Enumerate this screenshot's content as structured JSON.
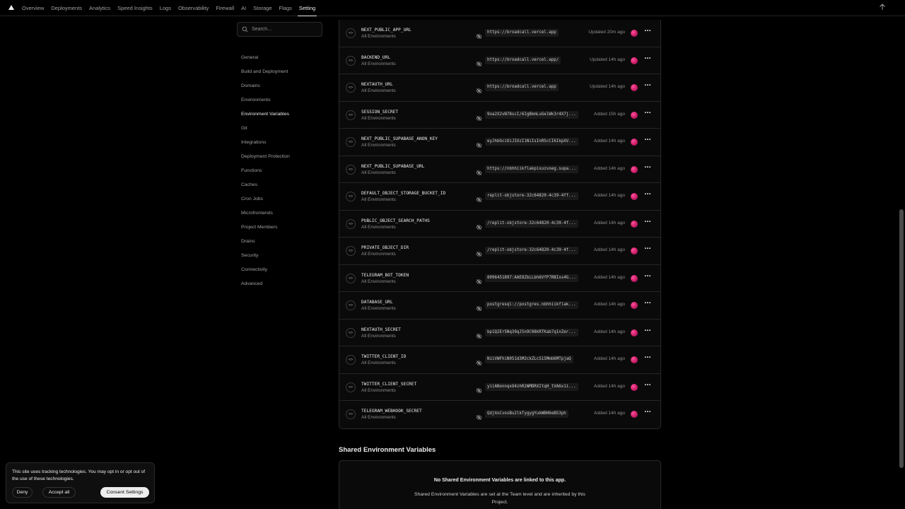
{
  "nav": {
    "tabs": [
      {
        "label": "Overview"
      },
      {
        "label": "Deployments"
      },
      {
        "label": "Analytics"
      },
      {
        "label": "Speed Insights"
      },
      {
        "label": "Logs"
      },
      {
        "label": "Observability"
      },
      {
        "label": "Firewall"
      },
      {
        "label": "AI"
      },
      {
        "label": "Storage"
      },
      {
        "label": "Flags"
      },
      {
        "label": "Setting"
      }
    ],
    "active_tab": "Setting"
  },
  "sidebar": {
    "search_placeholder": "Search...",
    "items": [
      {
        "label": "General"
      },
      {
        "label": "Build and Deployment"
      },
      {
        "label": "Domains"
      },
      {
        "label": "Environments"
      },
      {
        "label": "Environment Variables"
      },
      {
        "label": "Git"
      },
      {
        "label": "Integrations"
      },
      {
        "label": "Deployment Protection"
      },
      {
        "label": "Functions"
      },
      {
        "label": "Caches"
      },
      {
        "label": "Cron Jobs"
      },
      {
        "label": "Microfrontends"
      },
      {
        "label": "Project Members"
      },
      {
        "label": "Drains"
      },
      {
        "label": "Security"
      },
      {
        "label": "Connectivity"
      },
      {
        "label": "Advanced"
      }
    ],
    "active_item": "Environment Variables"
  },
  "env_vars": [
    {
      "name": "NEXT_PUBLIC_APP_URL",
      "env": "All Environments",
      "value": "https://broadcall.vercel.app",
      "time": "Updated 20m ago"
    },
    {
      "name": "BACKEND_URL",
      "env": "All Environments",
      "value": "https://broadcall.vercel.app/",
      "time": "Updated 14h ago"
    },
    {
      "name": "NEXTAUTH_URL",
      "env": "All Environments",
      "value": "https://broadcall.vercel.app",
      "time": "Updated 14h ago"
    },
    {
      "name": "SESSION_SECRET",
      "env": "All Environments",
      "value": "9oa2X2vN78scI/6IgBkmLuGelWk3r4X7j...",
      "time": "Added 15h ago"
    },
    {
      "name": "NEXT_PUBLIC_SUPABASE_ANON_KEY",
      "env": "All Environments",
      "value": "eyJhbGciOiJIUzI1NiIsInR5cCI6IkpXV...",
      "time": "Added 14h ago"
    },
    {
      "name": "NEXT_PUBLIC_SUPABASE_URL",
      "env": "All Environments",
      "value": "https://nbhhiikflakpixuzvoeg.supa...",
      "time": "Added 14h ago"
    },
    {
      "name": "DEFAULT_OBJECT_STORAGE_BUCKET_ID",
      "env": "All Environments",
      "value": "replit-objstore-32c64820-4c39-4ff...",
      "time": "Added 14h ago"
    },
    {
      "name": "PUBLIC_OBJECT_SEARCH_PATHS",
      "env": "All Environments",
      "value": "/replit-objstore-32c64820-4c39-4f...",
      "time": "Added 14h ago"
    },
    {
      "name": "PRIVATE_OBJECT_DIR",
      "env": "All Environments",
      "value": "/replit-objstore-32c64820-4c39-4f...",
      "time": "Added 14h ago"
    },
    {
      "name": "TELEGRAM_BOT_TOKEN",
      "env": "All Environments",
      "value": "8096451897:AAE8ZbLLbh6VfP7RBIxs4G...",
      "time": "Added 14h ago"
    },
    {
      "name": "DATABASE_URL",
      "env": "All Environments",
      "value": "postgresql://postgres.nbhhiikflak...",
      "time": "Added 14h ago"
    },
    {
      "name": "NEXTAUTH_SECRET",
      "env": "All Environments",
      "value": "bp1Q2Er5Nq39qJ5n9C08kRTKab7q1nZer...",
      "time": "Added 14h ago"
    },
    {
      "name": "TWITTER_CLIENT_ID",
      "env": "All Environments",
      "value": "NiiVWFhiN051d3M2ckZLcS15MmU6MTpjaQ",
      "time": "Added 14h ago"
    },
    {
      "name": "TWITTER_CLIENT_SECRET",
      "env": "All Environments",
      "value": "yiiANonnqxO4zhR2WMDRXItqH_tVA6x1i...",
      "time": "Added 14h ago"
    },
    {
      "name": "TELEGRAM_WEBHOOK_SECRET",
      "env": "All Environments",
      "value": "QdjXoCvosBu2lkTygygYukWBH6eB53ph",
      "time": "Added 14h ago"
    }
  ],
  "shared": {
    "title": "Shared Environment Variables",
    "empty_text": "No Shared Environment Variables are linked to this app.",
    "description": "Shared Environment Variables are set at the Team level and are inherited by this Project."
  },
  "cookie": {
    "text": "This site uses tracking technologies. You may opt in or opt out of the use of these technologies.",
    "deny_label": "Deny",
    "accept_label": "Accept all",
    "settings_label": "Consent Settings"
  },
  "colors": {
    "background": "#000000",
    "text": "#ededed",
    "muted": "#a1a1a1",
    "border": "#2a2a2a"
  }
}
